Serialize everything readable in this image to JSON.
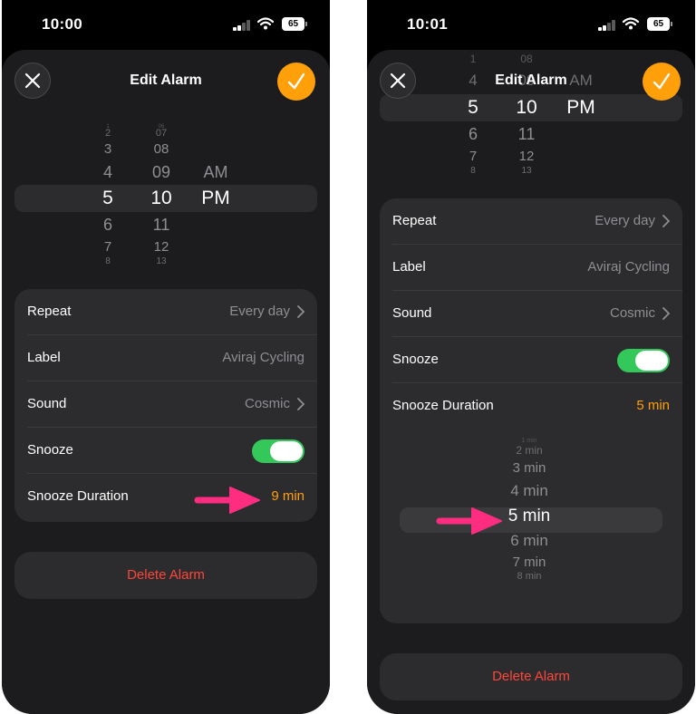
{
  "colors": {
    "accent": "#ff9f0a",
    "toggle_on": "#34c759",
    "delete": "#ff453a",
    "arrow": "#ff2d7f"
  },
  "left": {
    "status": {
      "time": "10:00",
      "battery": "65"
    },
    "title": "Edit Alarm",
    "picker": {
      "hours": [
        "1",
        "2",
        "3",
        "4",
        "5",
        "6",
        "7",
        "8"
      ],
      "minutes": [
        "06",
        "07",
        "08",
        "09",
        "10",
        "11",
        "12",
        "13"
      ],
      "periods": [
        "AM",
        "PM"
      ]
    },
    "rows": {
      "repeat": {
        "label": "Repeat",
        "value": "Every day"
      },
      "label": {
        "label": "Label",
        "value": "Aviraj Cycling"
      },
      "sound": {
        "label": "Sound",
        "value": "Cosmic"
      },
      "snooze": {
        "label": "Snooze",
        "on": true
      },
      "snooze_duration": {
        "label": "Snooze Duration",
        "value": "9 min"
      }
    },
    "delete_label": "Delete Alarm"
  },
  "right": {
    "status": {
      "time": "10:01",
      "battery": "65"
    },
    "title": "Edit Alarm",
    "picker": {
      "hours": [
        "1",
        "4",
        "5",
        "6",
        "7",
        "8"
      ],
      "minutes": [
        "08",
        "09",
        "10",
        "11",
        "12",
        "13"
      ],
      "periods": [
        "AM",
        "PM"
      ]
    },
    "rows": {
      "repeat": {
        "label": "Repeat",
        "value": "Every day"
      },
      "label": {
        "label": "Label",
        "value": "Aviraj Cycling"
      },
      "sound": {
        "label": "Sound",
        "value": "Cosmic"
      },
      "snooze": {
        "label": "Snooze",
        "on": true
      },
      "snooze_duration": {
        "label": "Snooze Duration",
        "value": "5 min"
      }
    },
    "duration_picker": [
      "1 min",
      "2 min",
      "3 min",
      "4 min",
      "5 min",
      "6 min",
      "7 min",
      "8 min"
    ],
    "delete_label": "Delete Alarm"
  }
}
